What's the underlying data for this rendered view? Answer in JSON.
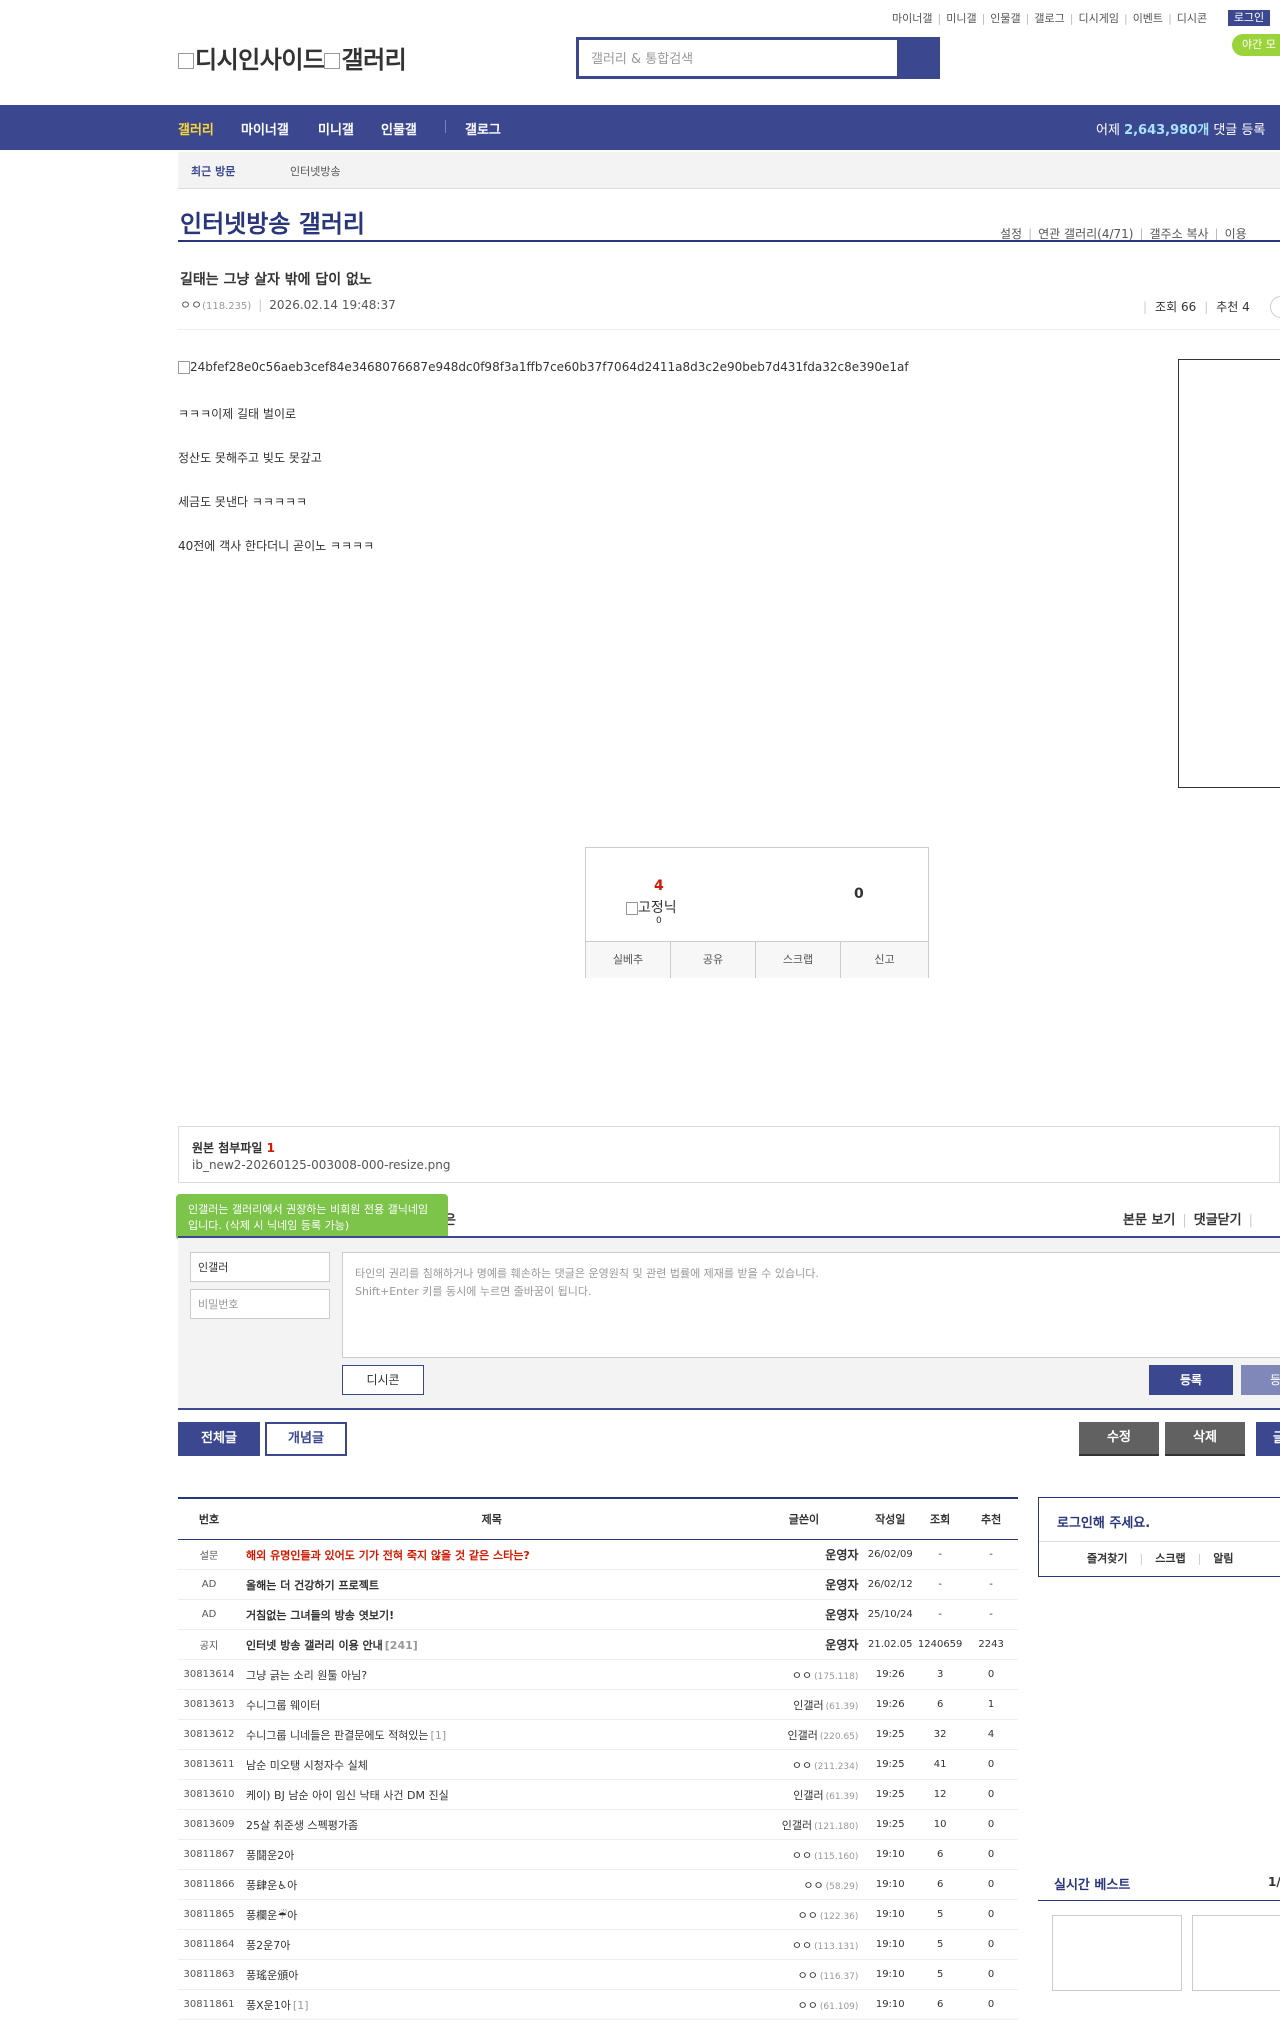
{
  "top_links": [
    "마이너갤",
    "미니갤",
    "인물갤",
    "갤로그",
    "디시게임",
    "이벤트",
    "디시콘"
  ],
  "login_label": "로그인",
  "night_mode_label": "야간 모",
  "logo": {
    "alt_text": "디시인사이드",
    "alt_text2": "갤러리"
  },
  "search": {
    "placeholder": "갤러리 & 통합검색"
  },
  "gnb": {
    "items": [
      "갤러리",
      "마이너갤",
      "미니갤",
      "인물갤",
      "갤로그"
    ],
    "stats_prefix": "어제 ",
    "stats_value": "2,643,980개",
    "stats_suffix": " 댓글 등록"
  },
  "recent": {
    "label": "최근 방문",
    "item": "인터넷방송"
  },
  "gallery": {
    "title": "인터넷방송 갤러리",
    "menu": [
      "설정",
      "연관 갤러리(4/71)",
      "갤주소 복사",
      "이용"
    ]
  },
  "post": {
    "title": "길태는 그냥 살자 밖에 답이 없노",
    "author": "ㅇㅇ",
    "author_ip": "(118.235)",
    "datetime": "2026.02.14 19:48:37",
    "views_label": "조회 66",
    "recommend_label": "추천 4",
    "image_alt": "24bfef28e0c56aeb3cef84e3468076687e948dc0f98f3a1ffb7ce60b37f7064d2411a8d3c2e90beb7d431fda32c8e390e1af",
    "body_lines": [
      "ㅋㅋㅋ이제 길태 벌이로",
      "정산도 못해주고 빚도 못갚고",
      "세금도 못낸다 ㅋㅋㅋㅋㅋ",
      "40전에 객사 한다더니 곧이노 ㅋㅋㅋㅋ"
    ]
  },
  "vote": {
    "up": "4",
    "fix_alt": "고정닉",
    "fix_count": "0",
    "down": "0",
    "actions": [
      "실베추",
      "공유",
      "스크랩",
      "신고"
    ]
  },
  "attachment": {
    "label": "원본 첨부파일",
    "count": "1",
    "file": "ib_new2-20260125-003008-000-resize.png"
  },
  "comment": {
    "tooltip": "인갤러는 갤러리에서 권장하는 비회원 전용 갤닉네임입니다. (삭제 시 닉네임 등록 가능)",
    "ghost_label": "은",
    "tools": [
      "본문 보기",
      "댓글닫기"
    ],
    "name_value": "인갤러",
    "password_placeholder": "비밀번호",
    "textarea_placeholder_1": "타인의 권리를 침해하거나 명예를 훼손하는 댓글은 운영원칙 및 관련 법률에 제재를 받을 수 있습니다.",
    "textarea_placeholder_2": "Shift+Enter 키를 동시에 누르면 줄바꿈이 됩니다.",
    "dccon_label": "디시콘",
    "submit_label": "등록",
    "submit2_label": "등록"
  },
  "buttons": {
    "all": "전체글",
    "best": "개념글",
    "edit": "수정",
    "delete": "삭제",
    "write": "글"
  },
  "list": {
    "headers": [
      "번호",
      "제목",
      "글쓴이",
      "작성일",
      "조회",
      "추천"
    ],
    "rows": [
      {
        "type": "survey",
        "num": "설문",
        "title": "해외 유명인들과 있어도 기가 전혀 죽지 않을 것 같은 스타는?",
        "comments": "",
        "writer": "운영자",
        "ip": "",
        "date": "26/02/09",
        "views": "-",
        "rec": "-"
      },
      {
        "type": "notice",
        "num": "AD",
        "title": "올해는 더 건강하기 프로젝트",
        "comments": "",
        "writer": "운영자",
        "ip": "",
        "date": "26/02/12",
        "views": "-",
        "rec": "-"
      },
      {
        "type": "notice",
        "num": "AD",
        "title": "거침없는 그녀들의 방송 엿보기!",
        "comments": "",
        "writer": "운영자",
        "ip": "",
        "date": "25/10/24",
        "views": "-",
        "rec": "-"
      },
      {
        "type": "notice",
        "num": "공지",
        "title": "인터넷 방송 갤러리 이용 안내",
        "comments": "[241]",
        "writer": "운영자",
        "ip": "",
        "date": "21.02.05",
        "views": "1240659",
        "rec": "2243"
      },
      {
        "type": "post",
        "num": "30813614",
        "title": "그냥 긁는 소리 원툴 아님?",
        "comments": "",
        "writer": "ㅇㅇ",
        "ip": "(175.118)",
        "date": "19:26",
        "views": "3",
        "rec": "0"
      },
      {
        "type": "post",
        "num": "30813613",
        "title": "수니그룹 웨이터",
        "comments": "",
        "writer": "인갤러",
        "ip": "(61.39)",
        "date": "19:26",
        "views": "6",
        "rec": "1"
      },
      {
        "type": "post",
        "num": "30813612",
        "title": "수니그룹 니네들은 판결문에도 적혀있는",
        "comments": "[1]",
        "writer": "인갤러",
        "ip": "(220.65)",
        "date": "19:25",
        "views": "32",
        "rec": "4"
      },
      {
        "type": "post",
        "num": "30813611",
        "title": "남순 미오탱 시청자수 실체",
        "comments": "",
        "writer": "ㅇㅇ",
        "ip": "(211.234)",
        "date": "19:25",
        "views": "41",
        "rec": "0"
      },
      {
        "type": "post",
        "num": "30813610",
        "title": "케이) BJ 남순 아이 임신 낙태 사건 DM 진실",
        "comments": "",
        "writer": "인갤러",
        "ip": "(61.39)",
        "date": "19:25",
        "views": "12",
        "rec": "0"
      },
      {
        "type": "post",
        "num": "30813609",
        "title": "25살 취준생 스펙평가좀",
        "comments": "",
        "writer": "인갤러",
        "ip": "(121.180)",
        "date": "19:25",
        "views": "10",
        "rec": "0"
      },
      {
        "type": "post",
        "num": "30811867",
        "title": "풍鬪운2아",
        "comments": "",
        "writer": "ㅇㅇ",
        "ip": "(115.160)",
        "date": "19:10",
        "views": "6",
        "rec": "0"
      },
      {
        "type": "post",
        "num": "30811866",
        "title": "풍肆운♿아",
        "comments": "",
        "writer": "ㅇㅇ",
        "ip": "(58.29)",
        "date": "19:10",
        "views": "6",
        "rec": "0"
      },
      {
        "type": "post",
        "num": "30811865",
        "title": "풍欄운☔아",
        "comments": "",
        "writer": "ㅇㅇ",
        "ip": "(122.36)",
        "date": "19:10",
        "views": "5",
        "rec": "0"
      },
      {
        "type": "post",
        "num": "30811864",
        "title": "풍2운7아",
        "comments": "",
        "writer": "ㅇㅇ",
        "ip": "(113.131)",
        "date": "19:10",
        "views": "5",
        "rec": "0"
      },
      {
        "type": "post",
        "num": "30811863",
        "title": "풍瑤운頒아",
        "comments": "",
        "writer": "ㅇㅇ",
        "ip": "(116.37)",
        "date": "19:10",
        "views": "5",
        "rec": "0"
      },
      {
        "type": "post",
        "num": "30811861",
        "title": "풍X운1아",
        "comments": "[1]",
        "writer": "ㅇㅇ",
        "ip": "(61.109)",
        "date": "19:10",
        "views": "6",
        "rec": "0"
      }
    ]
  },
  "sidebar": {
    "login_prompt": "로그인해 주세요.",
    "links": [
      "즐겨찾기",
      "스크랩",
      "알림"
    ],
    "best_title": "실시간 베스트",
    "best_page": "1/"
  },
  "colors": {
    "brand": "#3b4890",
    "brand_dark": "#29367c",
    "alert_red": "#d31900",
    "tooltip_green": "#7cc44a",
    "night_green": "#9bd43a"
  }
}
